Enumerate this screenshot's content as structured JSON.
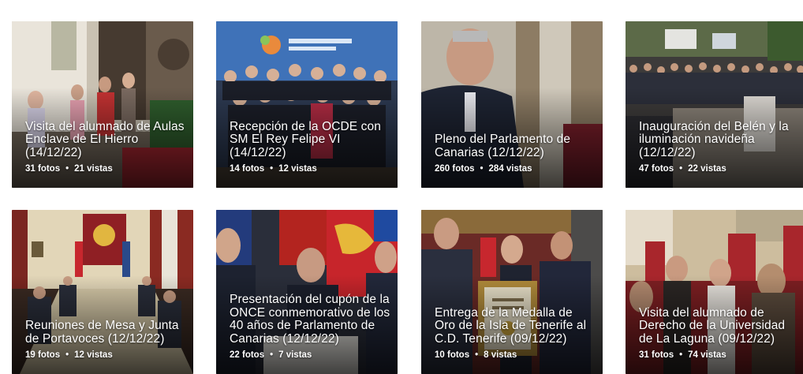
{
  "albums": [
    {
      "title": "Visita del alumnado de Aulas Enclave de El Hierro (14/12/22)",
      "photos": "31 fotos",
      "views": "21 vistas",
      "separator": "•",
      "thumb_icon": "group-visit-photo",
      "colors": [
        "#b9b1a3",
        "#6e6255",
        "#2f5e2d"
      ]
    },
    {
      "title": "Recepción de la OCDE con SM El Rey Felipe VI (14/12/22)",
      "photos": "14 fotos",
      "views": "12 vistas",
      "separator": "•",
      "thumb_icon": "group-photo-oecd",
      "colors": [
        "#3d6fb4",
        "#1d2130",
        "#8c2a35"
      ]
    },
    {
      "title": "Pleno del Parlamento de Canarias (12/12/22)",
      "photos": "260 fotos",
      "views": "284 vistas",
      "separator": "•",
      "thumb_icon": "speaker-photo",
      "colors": [
        "#c7c2b6",
        "#1f2533",
        "#6d5a44"
      ]
    },
    {
      "title": "Inauguración del Belén y la iluminación navideña (12/12/22)",
      "photos": "47 fotos",
      "views": "22 vistas",
      "separator": "•",
      "thumb_icon": "crowd-event-photo",
      "colors": [
        "#4b5a3b",
        "#2b2a2d",
        "#9c8e7c"
      ]
    },
    {
      "title": "Reuniones de Mesa y Junta de Portavoces (12/12/22)",
      "photos": "19 fotos",
      "views": "12 vistas",
      "separator": "•",
      "thumb_icon": "meeting-room-photo",
      "colors": [
        "#8a3a2a",
        "#d9c9a8",
        "#3a2a22"
      ]
    },
    {
      "title": "Presentación del cupón de la ONCE conmemorativo de los 40 años de Parlamento de Canarias (12/12/22)",
      "photos": "22 fotos",
      "views": "7 vistas",
      "separator": "•",
      "thumb_icon": "presentation-photo",
      "colors": [
        "#b31f26",
        "#1c2230",
        "#f0c040"
      ]
    },
    {
      "title": "Entrega de la Medalla de Oro de la Isla de Tenerife al C.D. Tenerife (09/12/22)",
      "photos": "10 fotos",
      "views": "8 vistas",
      "separator": "•",
      "thumb_icon": "award-ceremony-photo",
      "colors": [
        "#7a2a2a",
        "#222633",
        "#b08a3a"
      ]
    },
    {
      "title": "Visita del alumnado de Derecho de la Universidad de La Laguna (09/12/22)",
      "photos": "31 fotos",
      "views": "74 vistas",
      "separator": "•",
      "thumb_icon": "students-parliament-photo",
      "colors": [
        "#c9b9a0",
        "#9a2b2b",
        "#3b2f2a"
      ]
    }
  ]
}
